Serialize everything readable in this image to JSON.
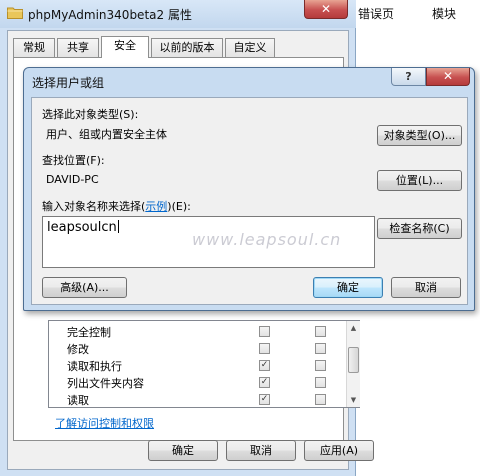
{
  "background_page": {
    "nav_items": [
      "错误页",
      "模块"
    ]
  },
  "properties_window": {
    "title": "phpMyAdmin340beta2 属性",
    "close_symbol": "✕",
    "tabs": [
      {
        "label": "常规"
      },
      {
        "label": "共享"
      },
      {
        "label": "安全"
      },
      {
        "label": "以前的版本"
      },
      {
        "label": "自定义"
      }
    ],
    "active_tab": "安全",
    "permissions": [
      {
        "name": "完全控制",
        "allow": false,
        "deny": false
      },
      {
        "name": "修改",
        "allow": false,
        "deny": false
      },
      {
        "name": "读取和执行",
        "allow": true,
        "deny": false
      },
      {
        "name": "列出文件夹内容",
        "allow": true,
        "deny": false
      },
      {
        "name": "读取",
        "allow": true,
        "deny": false
      }
    ],
    "check_mark": "✓",
    "learn_link": "了解访问控制和权限",
    "buttons": {
      "ok": "确定",
      "cancel": "取消",
      "apply": "应用(A)"
    }
  },
  "select_dialog": {
    "title": "选择用户或组",
    "help_symbol": "?",
    "close_symbol": "✕",
    "object_type_label": "选择此对象类型(S):",
    "object_type_value": "用户、组或内置安全主体",
    "object_types_button": "对象类型(O)...",
    "location_label": "查找位置(F):",
    "location_value": "DAVID-PC",
    "locations_button": "位置(L)...",
    "names_label_before": "输入对象名称来选择(",
    "names_label_link": "示例",
    "names_label_after": ")(E):",
    "names_value": "leapsoulcn",
    "check_names_button": "检查名称(C)",
    "advanced_button": "高级(A)...",
    "ok_button": "确定",
    "cancel_button": "取消"
  },
  "watermark": "www.leapsoul.cn"
}
